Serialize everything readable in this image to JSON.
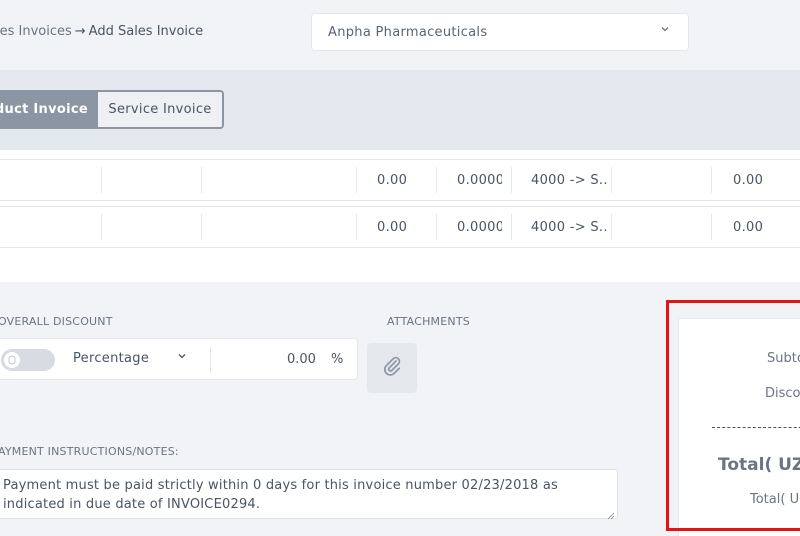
{
  "breadcrumb": {
    "parent": "les Invoices",
    "separator": "→",
    "current": "Add Sales Invoice"
  },
  "company_select": {
    "value": "Anpha Pharmaceuticals",
    "chevron_icon": "chevron-down-icon"
  },
  "invoice_type": {
    "product_label": "duct Invoice",
    "service_label": "Service Invoice",
    "active": "product"
  },
  "table": {
    "rows": [
      {
        "qty": "0.00",
        "rate": "0.0000",
        "account": "4000 -> S...",
        "amount": "0.00"
      },
      {
        "qty": "0.00",
        "rate": "0.0000",
        "account": "4000 -> S...",
        "amount": "0.00"
      }
    ]
  },
  "overall_discount": {
    "label": "OVERALL DISCOUNT",
    "type": "Percentage",
    "value": "0.00",
    "unit": "%"
  },
  "attachments": {
    "label": "ATTACHMENTS",
    "icon": "paperclip-icon"
  },
  "notes": {
    "label": "AYMENT INSTRUCTIONS/NOTES:",
    "text": "Payment must be paid strictly within 0 days for this invoice number 02/23/2018 as indicated in due date of INVOICE0294."
  },
  "summary": {
    "subtotal_label": "Subto",
    "discount_label": "Disco",
    "total_big_label": "Total( UZ",
    "total_small_label": "Total( U"
  },
  "colors": {
    "highlight": "#e31414",
    "toggle_active": "#8b95a3"
  }
}
